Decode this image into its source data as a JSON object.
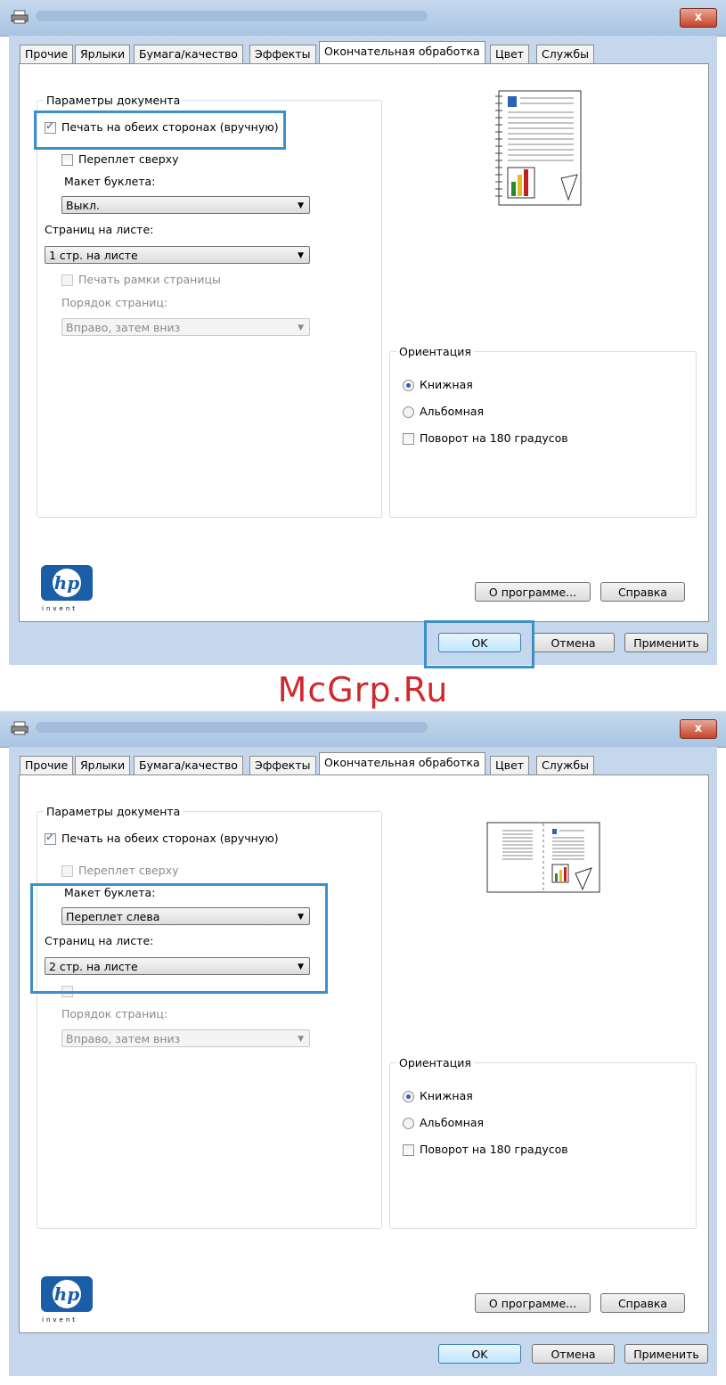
{
  "watermark": "McGrp.Ru",
  "dialogs": [
    {
      "close_label": "x",
      "tabs": [
        "Прочие",
        "Ярлыки",
        "Бумага/качество",
        "Эффекты",
        "Окончательная обработка",
        "Цвет",
        "Службы"
      ],
      "active_tab": 4,
      "doc_options": {
        "group_label": "Параметры документа",
        "duplex": {
          "label": "Печать на обеих сторонах (вручную)",
          "checked": true
        },
        "flip_top": {
          "label": "Переплет сверху",
          "checked": false
        },
        "booklet_label": "Макет буклета:",
        "booklet_value": "Выкл.",
        "pages_per_sheet_label": "Страниц на листе:",
        "pages_per_sheet_value": "1 стр. на листе",
        "print_borders": {
          "label": "Печать рамки страницы",
          "checked": false
        },
        "page_order_label": "Порядок страниц:",
        "page_order_value": "Вправо, затем вниз"
      },
      "orientation": {
        "group_label": "Ориентация",
        "portrait": "Книжная",
        "landscape": "Альбомная",
        "rotate": "Поворот на 180 градусов"
      },
      "logo_text": "invent",
      "buttons": {
        "about": "О программе...",
        "help": "Справка",
        "ok": "OK",
        "cancel": "Отмена",
        "apply": "Применить"
      }
    },
    {
      "close_label": "x",
      "tabs": [
        "Прочие",
        "Ярлыки",
        "Бумага/качество",
        "Эффекты",
        "Окончательная обработка",
        "Цвет",
        "Службы"
      ],
      "active_tab": 4,
      "doc_options": {
        "group_label": "Параметры документа",
        "duplex": {
          "label": "Печать на обеих сторонах (вручную)",
          "checked": true
        },
        "flip_top": {
          "label": "Переплет сверху",
          "checked": false
        },
        "booklet_label": "Макет буклета:",
        "booklet_value": "Переплет слева",
        "pages_per_sheet_label": "Страниц на листе:",
        "pages_per_sheet_value": "2 стр. на листе",
        "page_order_label": "Порядок страниц:",
        "page_order_value": "Вправо, затем вниз"
      },
      "orientation": {
        "group_label": "Ориентация",
        "portrait": "Книжная",
        "landscape": "Альбомная",
        "rotate": "Поворот на 180 градусов"
      },
      "logo_text": "invent",
      "buttons": {
        "about": "О программе...",
        "help": "Справка",
        "ok": "OK",
        "cancel": "Отмена",
        "apply": "Применить"
      }
    }
  ],
  "colors": {
    "highlight": "#3d8fc8",
    "watermark": "#d0282d",
    "hp_blue": "#1a5ea8"
  }
}
